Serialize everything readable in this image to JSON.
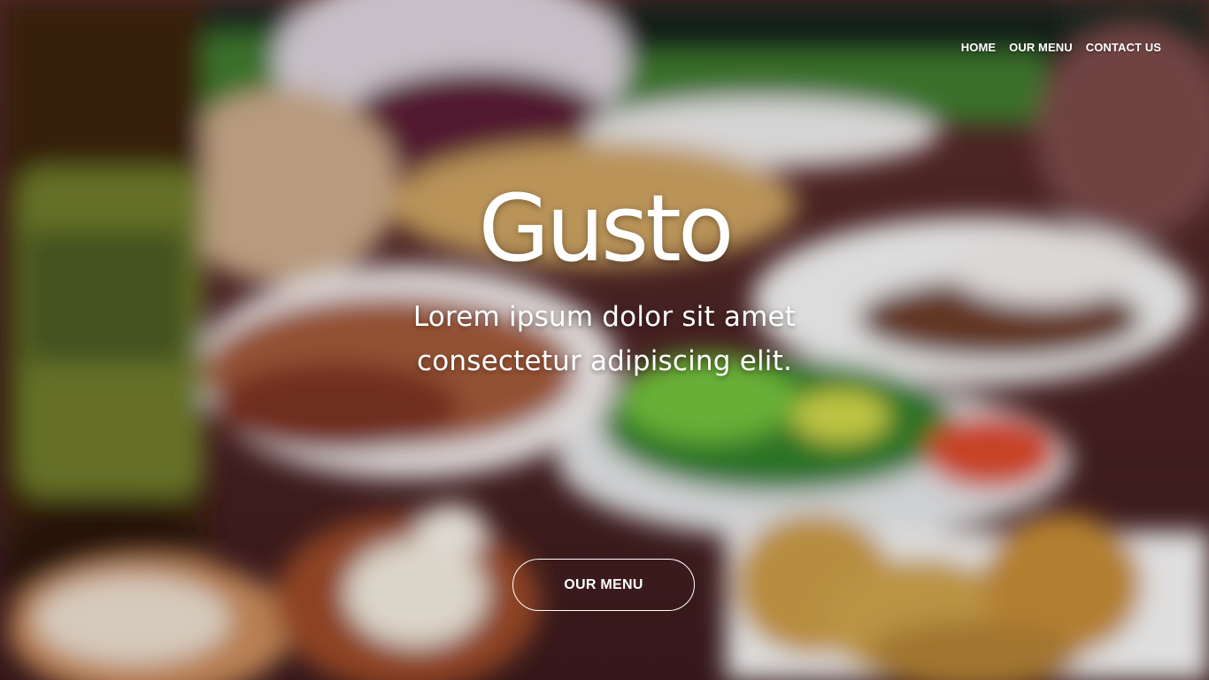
{
  "nav": {
    "items": [
      {
        "label": "HOME"
      },
      {
        "label": "OUR MENU"
      },
      {
        "label": "CONTACT US"
      }
    ]
  },
  "hero": {
    "title": "Gusto",
    "subtitle_line1": "Lorem ipsum dolor sit amet",
    "subtitle_line2": "consectetur adipiscing elit.",
    "cta_label": "OUR MENU",
    "background": "blurred-food-table-photo"
  },
  "colors": {
    "text": "#ffffff",
    "button_border": "#ffffff"
  }
}
